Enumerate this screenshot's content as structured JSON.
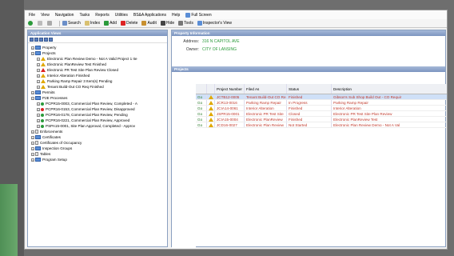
{
  "menubar": [
    "File",
    "View",
    "Navigation",
    "Tasks",
    "Reports",
    "Utilities",
    "BS&A Applications",
    "Help",
    "Full Screen"
  ],
  "toolbar": {
    "search": "Search",
    "index": "Index",
    "add": "Add",
    "delete": "Delete",
    "audit": "Audit",
    "hide": "Hide",
    "tools": "Tools",
    "inspectors_view": "Inspector's View"
  },
  "left_panel": {
    "title": "Application Views",
    "tree": [
      {
        "label": "Property",
        "icon": "folder",
        "level": 0
      },
      {
        "label": "Projects",
        "icon": "folder",
        "level": 0
      },
      {
        "label": "Electronic Plan Review Demo - Not A Valid Project 1 Ite",
        "icon": "warning-yellow",
        "level": 1
      },
      {
        "label": "Electronic PlanReview Test Finished",
        "icon": "warning-yellow",
        "level": 1
      },
      {
        "label": "Electronic PR Test Site Plan Review Closed",
        "icon": "warning-red",
        "level": 1
      },
      {
        "label": "Interior Alteration Finished",
        "icon": "warning-yellow",
        "level": 1
      },
      {
        "label": "Parking Ramp Repair 3 Item(s) Pending",
        "icon": "warning-yellow",
        "level": 1
      },
      {
        "label": "Tenant Build-Out CO Req Finished",
        "icon": "warning-yellow",
        "level": 1
      },
      {
        "label": "Permits",
        "icon": "folder",
        "level": 0
      },
      {
        "label": "P2E Processes",
        "icon": "folder",
        "level": 0
      },
      {
        "label": "PCPR15-0003, Commercial Plan Review, Completed - A",
        "icon": "dot-green",
        "level": 1
      },
      {
        "label": "PCPR16-0153, Commercial Plan Review, Disapproved",
        "icon": "dot-red",
        "level": 1
      },
      {
        "label": "PCPR16-0178, Commercial Plan Review, Pending",
        "icon": "dot-green",
        "level": 1
      },
      {
        "label": "PCPR16-0221, Commercial Plan Review, Approved",
        "icon": "dot-green",
        "level": 1
      },
      {
        "label": "PSPA15-0001, Site Plan Approval, Completed - Approv",
        "icon": "dot-green",
        "level": 1
      },
      {
        "label": "Enforcements",
        "icon": "doc",
        "level": 0
      },
      {
        "label": "Certificates",
        "icon": "folder",
        "level": 0
      },
      {
        "label": "Certificates of Occupancy",
        "icon": "doc",
        "level": 0
      },
      {
        "label": "Inspection Groups",
        "icon": "folder",
        "level": 0
      },
      {
        "label": "Tables",
        "icon": "doc",
        "level": 0
      },
      {
        "label": "Program Setup",
        "icon": "folder",
        "level": 0
      }
    ]
  },
  "right_panel": {
    "title": "Property Information",
    "address_label": "Address:",
    "address": "316 N CAPITOL AVE",
    "owner_label": "Owner:",
    "owner": "CITY OF LANSING",
    "projects_title": "Projects",
    "columns": [
      "",
      "",
      "Project Number",
      "Filed As",
      "Status",
      "Description"
    ],
    "rows": [
      {
        "go": "Go",
        "number": "JCTB12-0005",
        "filed": "Tenant Build-Out CO Re",
        "status": "Finished",
        "desc": "Gibson's Sub Shop Build Out - CO Requir",
        "selected": true
      },
      {
        "go": "Go",
        "number": "JCR13-0016",
        "filed": "Parking Ramp Repair",
        "status": "In Progress",
        "desc": "Parking Ramp Repair",
        "selected": false
      },
      {
        "go": "Go",
        "number": "JCIA14-0061",
        "filed": "Interior Alteration",
        "status": "Finished",
        "desc": "Interior Alteration",
        "selected": false
      },
      {
        "go": "Go",
        "number": "JSPR15-0001",
        "filed": "Electronic PR Test Site",
        "status": "Closed",
        "desc": "Electronic PR Test Site Plan Review",
        "selected": false
      },
      {
        "go": "Go",
        "number": "JCIA15-0004",
        "filed": "Electronic PlanReview",
        "status": "Finished",
        "desc": "Electronic PlanReview Test",
        "selected": false
      },
      {
        "go": "Go",
        "number": "JCD16-0027",
        "filed": "Electronic Plan Review",
        "status": "Not Started",
        "desc": "Electronic Plan Review Demo - Not A Val",
        "selected": false
      }
    ]
  },
  "colors": {
    "accent_green": "#2a9a3a",
    "row_text": "#c0392b",
    "selected_row": "#cfe0f7",
    "panel_title": "#7c95c0"
  }
}
